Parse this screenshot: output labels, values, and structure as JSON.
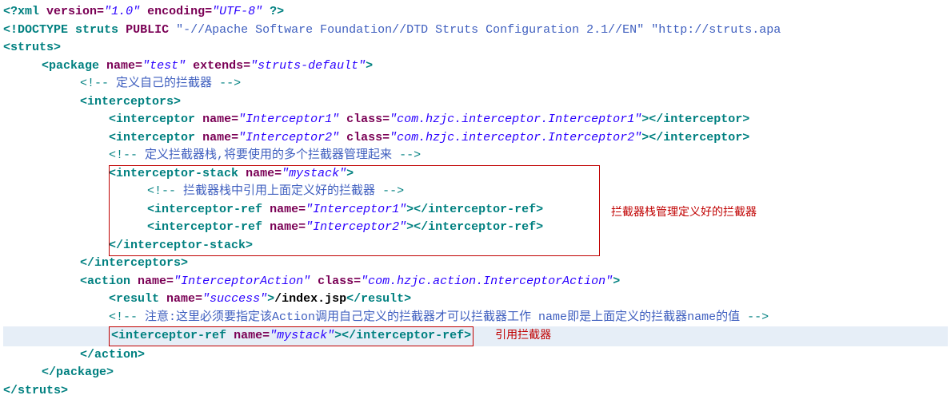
{
  "line1": {
    "xmlDecl": "xml",
    "attrVersion": "version=",
    "valVersion": "\"1.0\"",
    "attrEnc": "encoding=",
    "valEnc": "\"UTF-8\""
  },
  "line2": {
    "doctype": "DOCTYPE struts",
    "public": "PUBLIC",
    "dtd1": "\"-//Apache Software Foundation//DTD Struts Configuration 2.1//EN\"",
    "dtd2": "\"http://struts.apa"
  },
  "tags": {
    "struts": "struts",
    "strutsClose": "/struts",
    "package": "package",
    "packageClose": "/package",
    "interceptors": "interceptors",
    "interceptorsClose": "/interceptors",
    "interceptor": "interceptor",
    "interceptorClose": "/interceptor",
    "interceptorStack": "interceptor-stack",
    "interceptorStackClose": "/interceptor-stack",
    "interceptorRef": "interceptor-ref",
    "interceptorRefClose": "/interceptor-ref",
    "action": "action",
    "actionClose": "/action",
    "result": "result",
    "resultClose": "/result"
  },
  "attrs": {
    "name": "name=",
    "extends": "extends=",
    "class": "class="
  },
  "vals": {
    "pkgName": "\"test\"",
    "pkgExtends": "\"struts-default\"",
    "int1name": "\"Interceptor1\"",
    "int1class": "\"com.hzjc.interceptor.Interceptor1\"",
    "int2name": "\"Interceptor2\"",
    "int2class": "\"com.hzjc.interceptor.Interceptor2\"",
    "stackName": "\"mystack\"",
    "ref1": "\"Interceptor1\"",
    "ref2": "\"Interceptor2\"",
    "actionName": "\"InterceptorAction\"",
    "actionClass": "\"com.hzjc.action.InterceptorAction\"",
    "resultName": "\"success\"",
    "refStack": "\"mystack\""
  },
  "text": {
    "indexJsp": "/index.jsp"
  },
  "comments": {
    "c1": "定义自己的拦截器",
    "c2": "定义拦截器栈,将要使用的多个拦截器管理起来",
    "c3": "拦截器栈中引用上面定义好的拦截器",
    "c4a": "注意:这里必须要指定该Action调用自己定义的拦截器才可以拦截器工作 name",
    "c4b": "即是上面定义的拦截器name的值"
  },
  "annotations": {
    "note1": "拦截器栈管理定义好的拦截器",
    "note2": "引用拦截器"
  }
}
